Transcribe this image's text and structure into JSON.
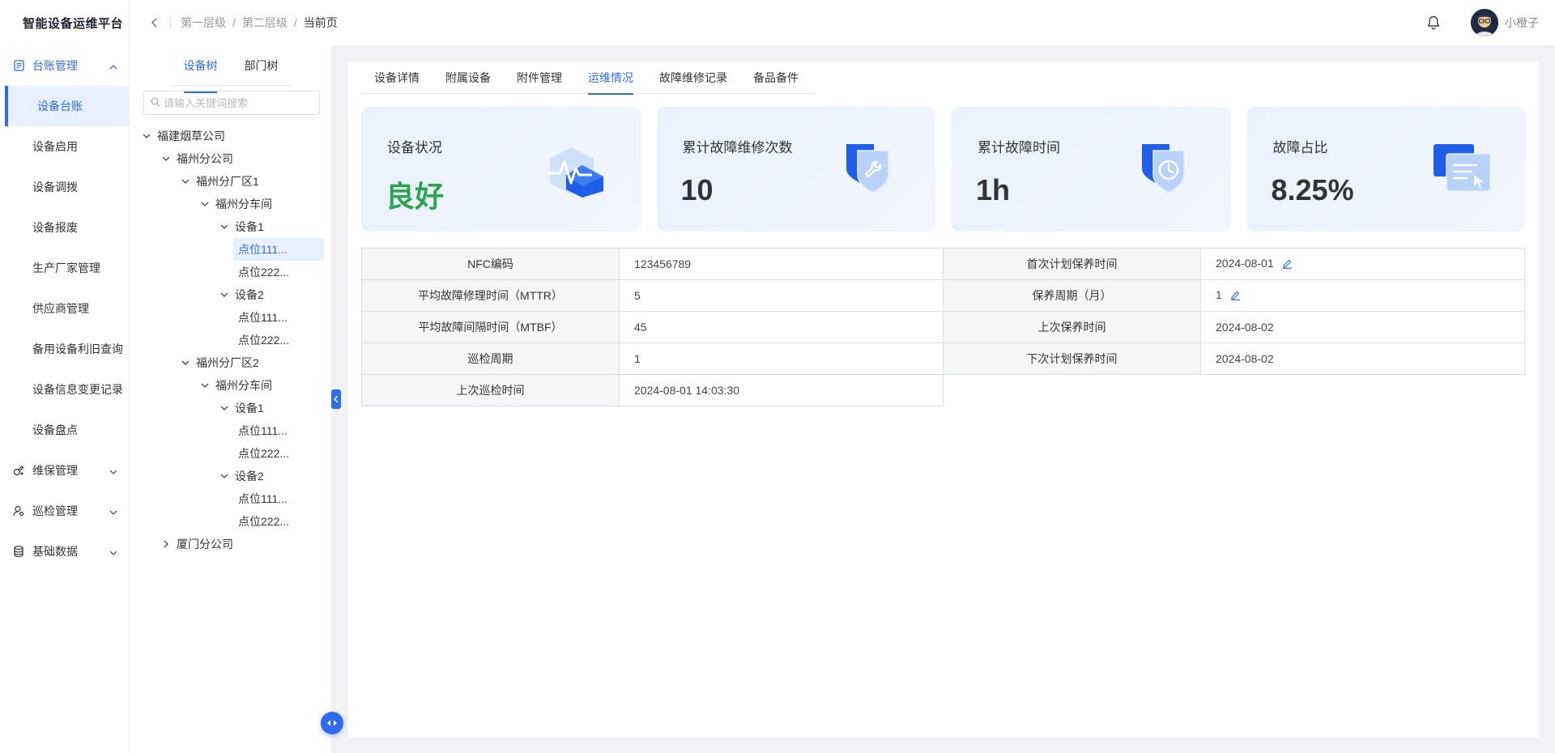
{
  "app": {
    "title": "智能设备运维平台"
  },
  "sidebar": {
    "groups": [
      {
        "label": "台账管理",
        "icon": "ledger-icon",
        "expanded": true,
        "items": [
          "设备台账",
          "设备启用",
          "设备调拨",
          "设备报废",
          "生产厂家管理",
          "供应商管理",
          "备用设备利旧查询",
          "设备信息变更记录",
          "设备盘点"
        ],
        "active_item": "设备台账"
      },
      {
        "label": "维保管理",
        "icon": "maintenance-icon",
        "expanded": false
      },
      {
        "label": "巡检管理",
        "icon": "inspector-icon",
        "expanded": false
      },
      {
        "label": "基础数据",
        "icon": "database-icon",
        "expanded": false
      }
    ]
  },
  "header": {
    "breadcrumb": [
      "第一层级",
      "第二层级",
      "当前页"
    ],
    "username": "小橙子"
  },
  "tree_panel": {
    "tabs": [
      "设备树",
      "部门树"
    ],
    "active_tab": "设备树",
    "search_placeholder": "请输入关键词搜索",
    "nodes": [
      {
        "label": "福建烟草公司",
        "level": 0,
        "expanded": true
      },
      {
        "label": "福州分公司",
        "level": 1,
        "expanded": true
      },
      {
        "label": "福州分厂区1",
        "level": 2,
        "expanded": true
      },
      {
        "label": "福州分车间",
        "level": 3,
        "expanded": true
      },
      {
        "label": "设备1",
        "level": 4,
        "expanded": true
      },
      {
        "label": "点位111...",
        "level": 5,
        "leaf": true,
        "selected": true
      },
      {
        "label": "点位222...",
        "level": 5,
        "leaf": true
      },
      {
        "label": "设备2",
        "level": 4,
        "expanded": true
      },
      {
        "label": "点位111...",
        "level": 5,
        "leaf": true
      },
      {
        "label": "点位222...",
        "level": 5,
        "leaf": true
      },
      {
        "label": "福州分厂区2",
        "level": 2,
        "expanded": true
      },
      {
        "label": "福州分车间",
        "level": 3,
        "expanded": true
      },
      {
        "label": "设备1",
        "level": 4,
        "expanded": true
      },
      {
        "label": "点位111...",
        "level": 5,
        "leaf": true
      },
      {
        "label": "点位222...",
        "level": 5,
        "leaf": true
      },
      {
        "label": "设备2",
        "level": 4,
        "expanded": true
      },
      {
        "label": "点位111...",
        "level": 5,
        "leaf": true
      },
      {
        "label": "点位222...",
        "level": 5,
        "leaf": true
      },
      {
        "label": "厦门分公司",
        "level": 1,
        "expanded": false
      }
    ]
  },
  "content": {
    "tabs": [
      "设备详情",
      "附属设备",
      "附件管理",
      "运维情况",
      "故障维修记录",
      "备品备件"
    ],
    "active_tab": "运维情况",
    "cards": [
      {
        "title": "设备状况",
        "value": "良好",
        "icon": "pulse-cube-icon",
        "status_color": "#2ea44f"
      },
      {
        "title": "累计故障维修次数",
        "value": "10",
        "icon": "wrench-shield-icon"
      },
      {
        "title": "累计故障时间",
        "value": "1h",
        "icon": "clock-shield-icon"
      },
      {
        "title": "故障占比",
        "value": "8.25%",
        "icon": "document-pointer-icon"
      }
    ],
    "info_rows": [
      {
        "label1": "NFC编码",
        "value1": "123456789",
        "label2": "首次计划保养时间",
        "value2": "2024-08-01",
        "editable2": true
      },
      {
        "label1": "平均故障修理时间（MTTR）",
        "value1": "5",
        "label2": "保养周期（月）",
        "value2": "1",
        "editable2": true
      },
      {
        "label1": "平均故障间隔时间（MTBF）",
        "value1": "45",
        "label2": "上次保养时间",
        "value2": "2024-08-02"
      },
      {
        "label1": "巡检周期",
        "value1": "1",
        "label2": "下次计划保养时间",
        "value2": "2024-08-02"
      },
      {
        "label1": "上次巡检时间",
        "value1": "2024-08-01 14:03:30"
      }
    ]
  },
  "colors": {
    "accent": "#2f6bf0",
    "good": "#2ea44f"
  }
}
